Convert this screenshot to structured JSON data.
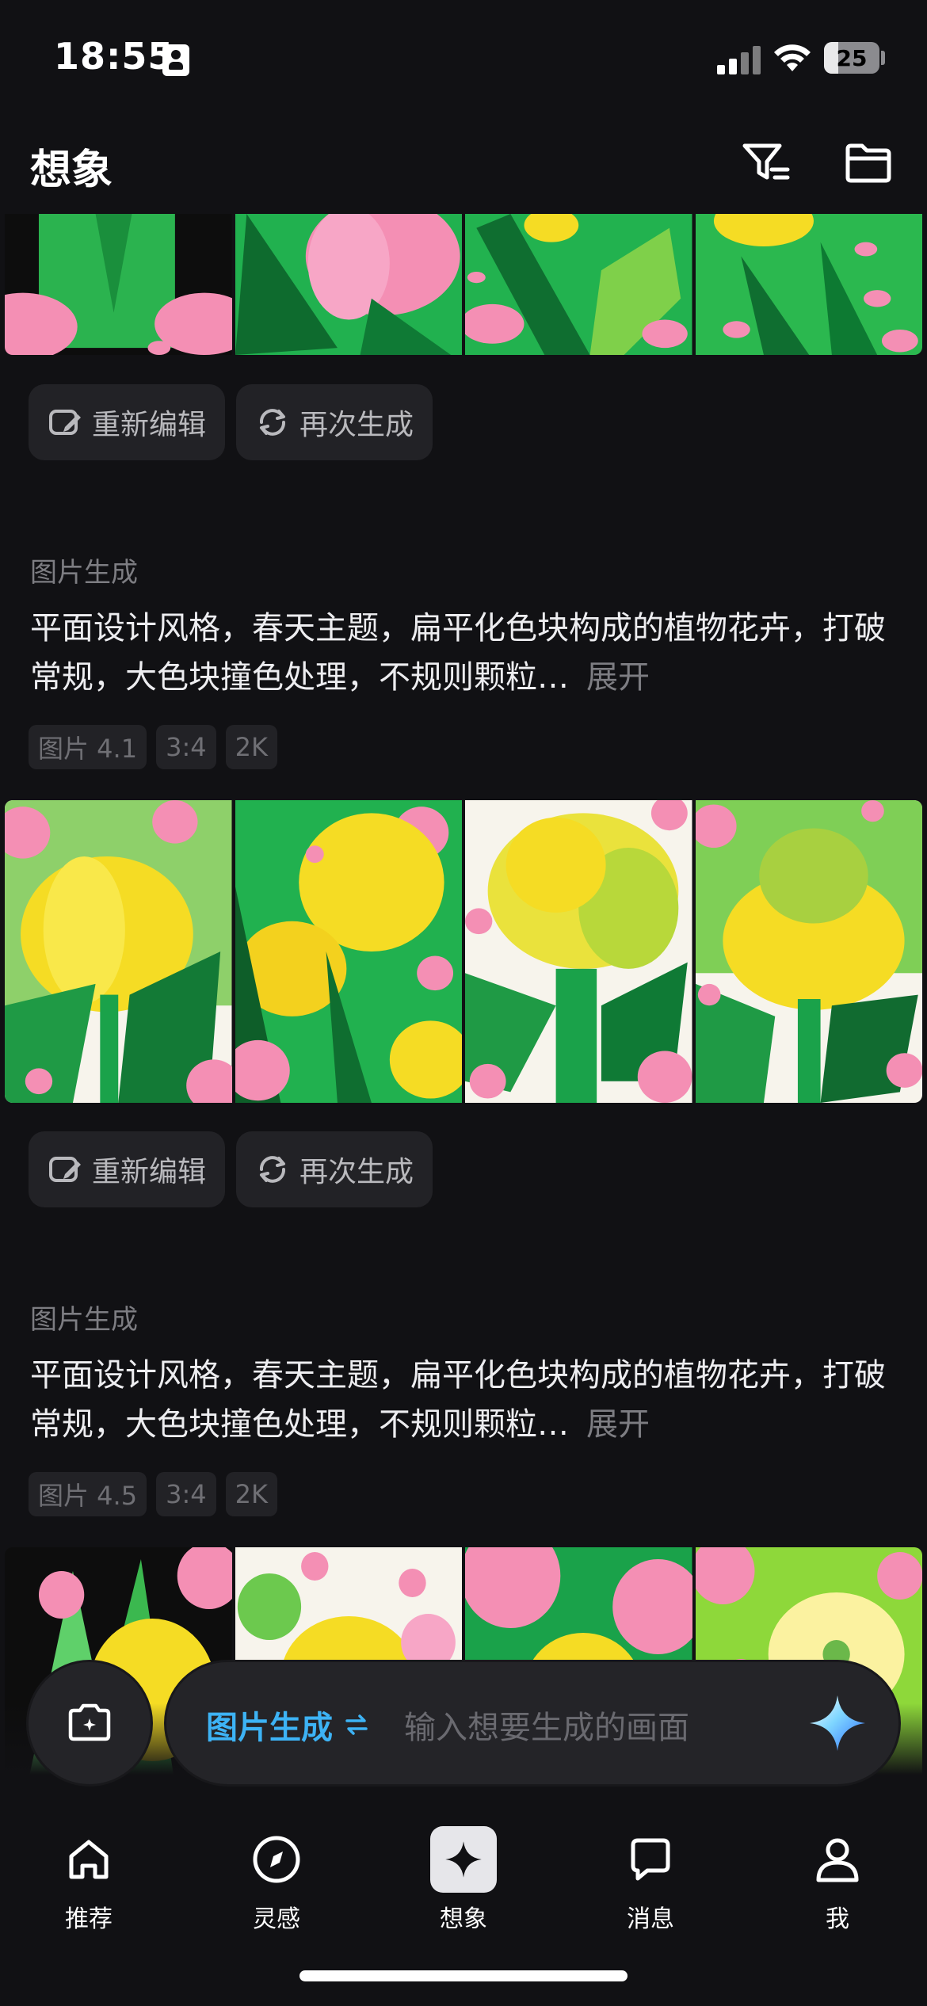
{
  "status_bar": {
    "time": "18:55",
    "battery": "25",
    "battery_level": 0.25
  },
  "header": {
    "title": "想象",
    "filter_icon": "filter-icon",
    "folder_icon": "folder-icon"
  },
  "action_labels": {
    "reedit": "重新编辑",
    "regenerate": "再次生成"
  },
  "cards": [
    {
      "label": "图片生成",
      "prompt": "平面设计风格，春天主题，扁平化色块构成的植物花卉，打破常规，大色块撞色处理，不规则颗粒…",
      "expand": "展开",
      "tags": [
        "图片 4.1",
        "3:4",
        "2K"
      ]
    },
    {
      "label": "图片生成",
      "prompt": "平面设计风格，春天主题，扁平化色块构成的植物花卉，打破常规，大色块撞色处理，不规则颗粒…",
      "expand": "展开",
      "tags": [
        "图片 4.5",
        "3:4",
        "2K"
      ]
    }
  ],
  "composer": {
    "mode": "图片生成",
    "mode_switch_icon": "swap-icon",
    "placeholder": "输入想要生成的画面",
    "camera_icon": "camera-plus-icon",
    "send_icon": "sparkle-icon"
  },
  "tabs": [
    {
      "label": "推荐",
      "icon": "home-icon",
      "active": false
    },
    {
      "label": "灵感",
      "icon": "compass-icon",
      "active": false
    },
    {
      "label": "想象",
      "icon": "sparkle-icon",
      "active": true
    },
    {
      "label": "消息",
      "icon": "chat-icon",
      "active": false
    },
    {
      "label": "我",
      "icon": "person-icon",
      "active": false
    }
  ],
  "colors": {
    "background": "#111114",
    "accent": "#3db3f5",
    "muted_text": "#7d7d82",
    "chip_bg": "#222226",
    "flower_pink": "#f48fb4",
    "flower_yellow": "#f5dc24",
    "leaf_green": "#1aa24a"
  }
}
